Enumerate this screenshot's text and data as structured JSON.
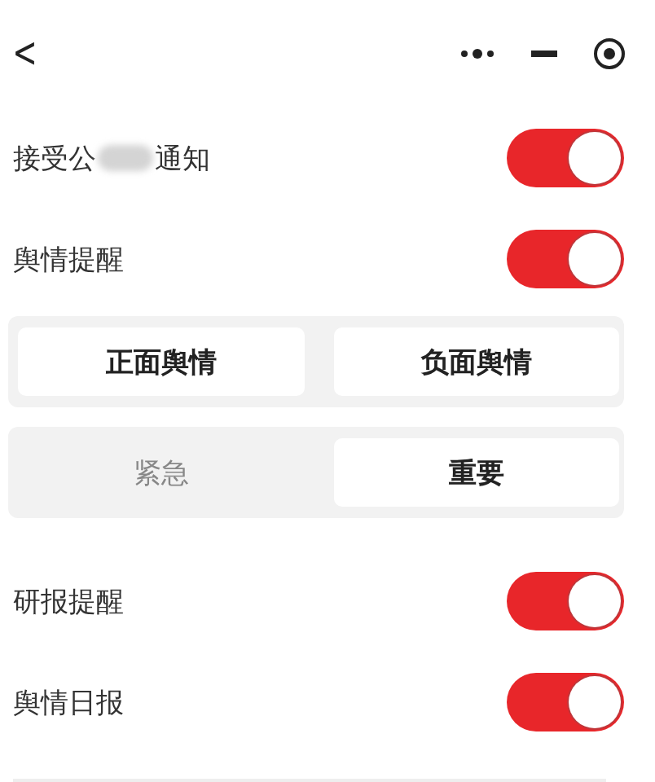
{
  "nav": {
    "back": "<"
  },
  "toggle_rows": [
    {
      "label": "接受公",
      "label_after": "通知",
      "redacted": true,
      "on": true
    },
    {
      "label": "舆情提醒",
      "on": true
    }
  ],
  "segment_groups": [
    {
      "options": [
        {
          "label": "正面舆情",
          "selected": true
        },
        {
          "label": "负面舆情",
          "selected": true
        }
      ]
    },
    {
      "options": [
        {
          "label": "紧急",
          "selected": false
        },
        {
          "label": "重要",
          "selected": true
        }
      ]
    }
  ],
  "toggle_rows_2": [
    {
      "label": "研报提醒",
      "on": true
    },
    {
      "label": "舆情日报",
      "on": true
    }
  ]
}
